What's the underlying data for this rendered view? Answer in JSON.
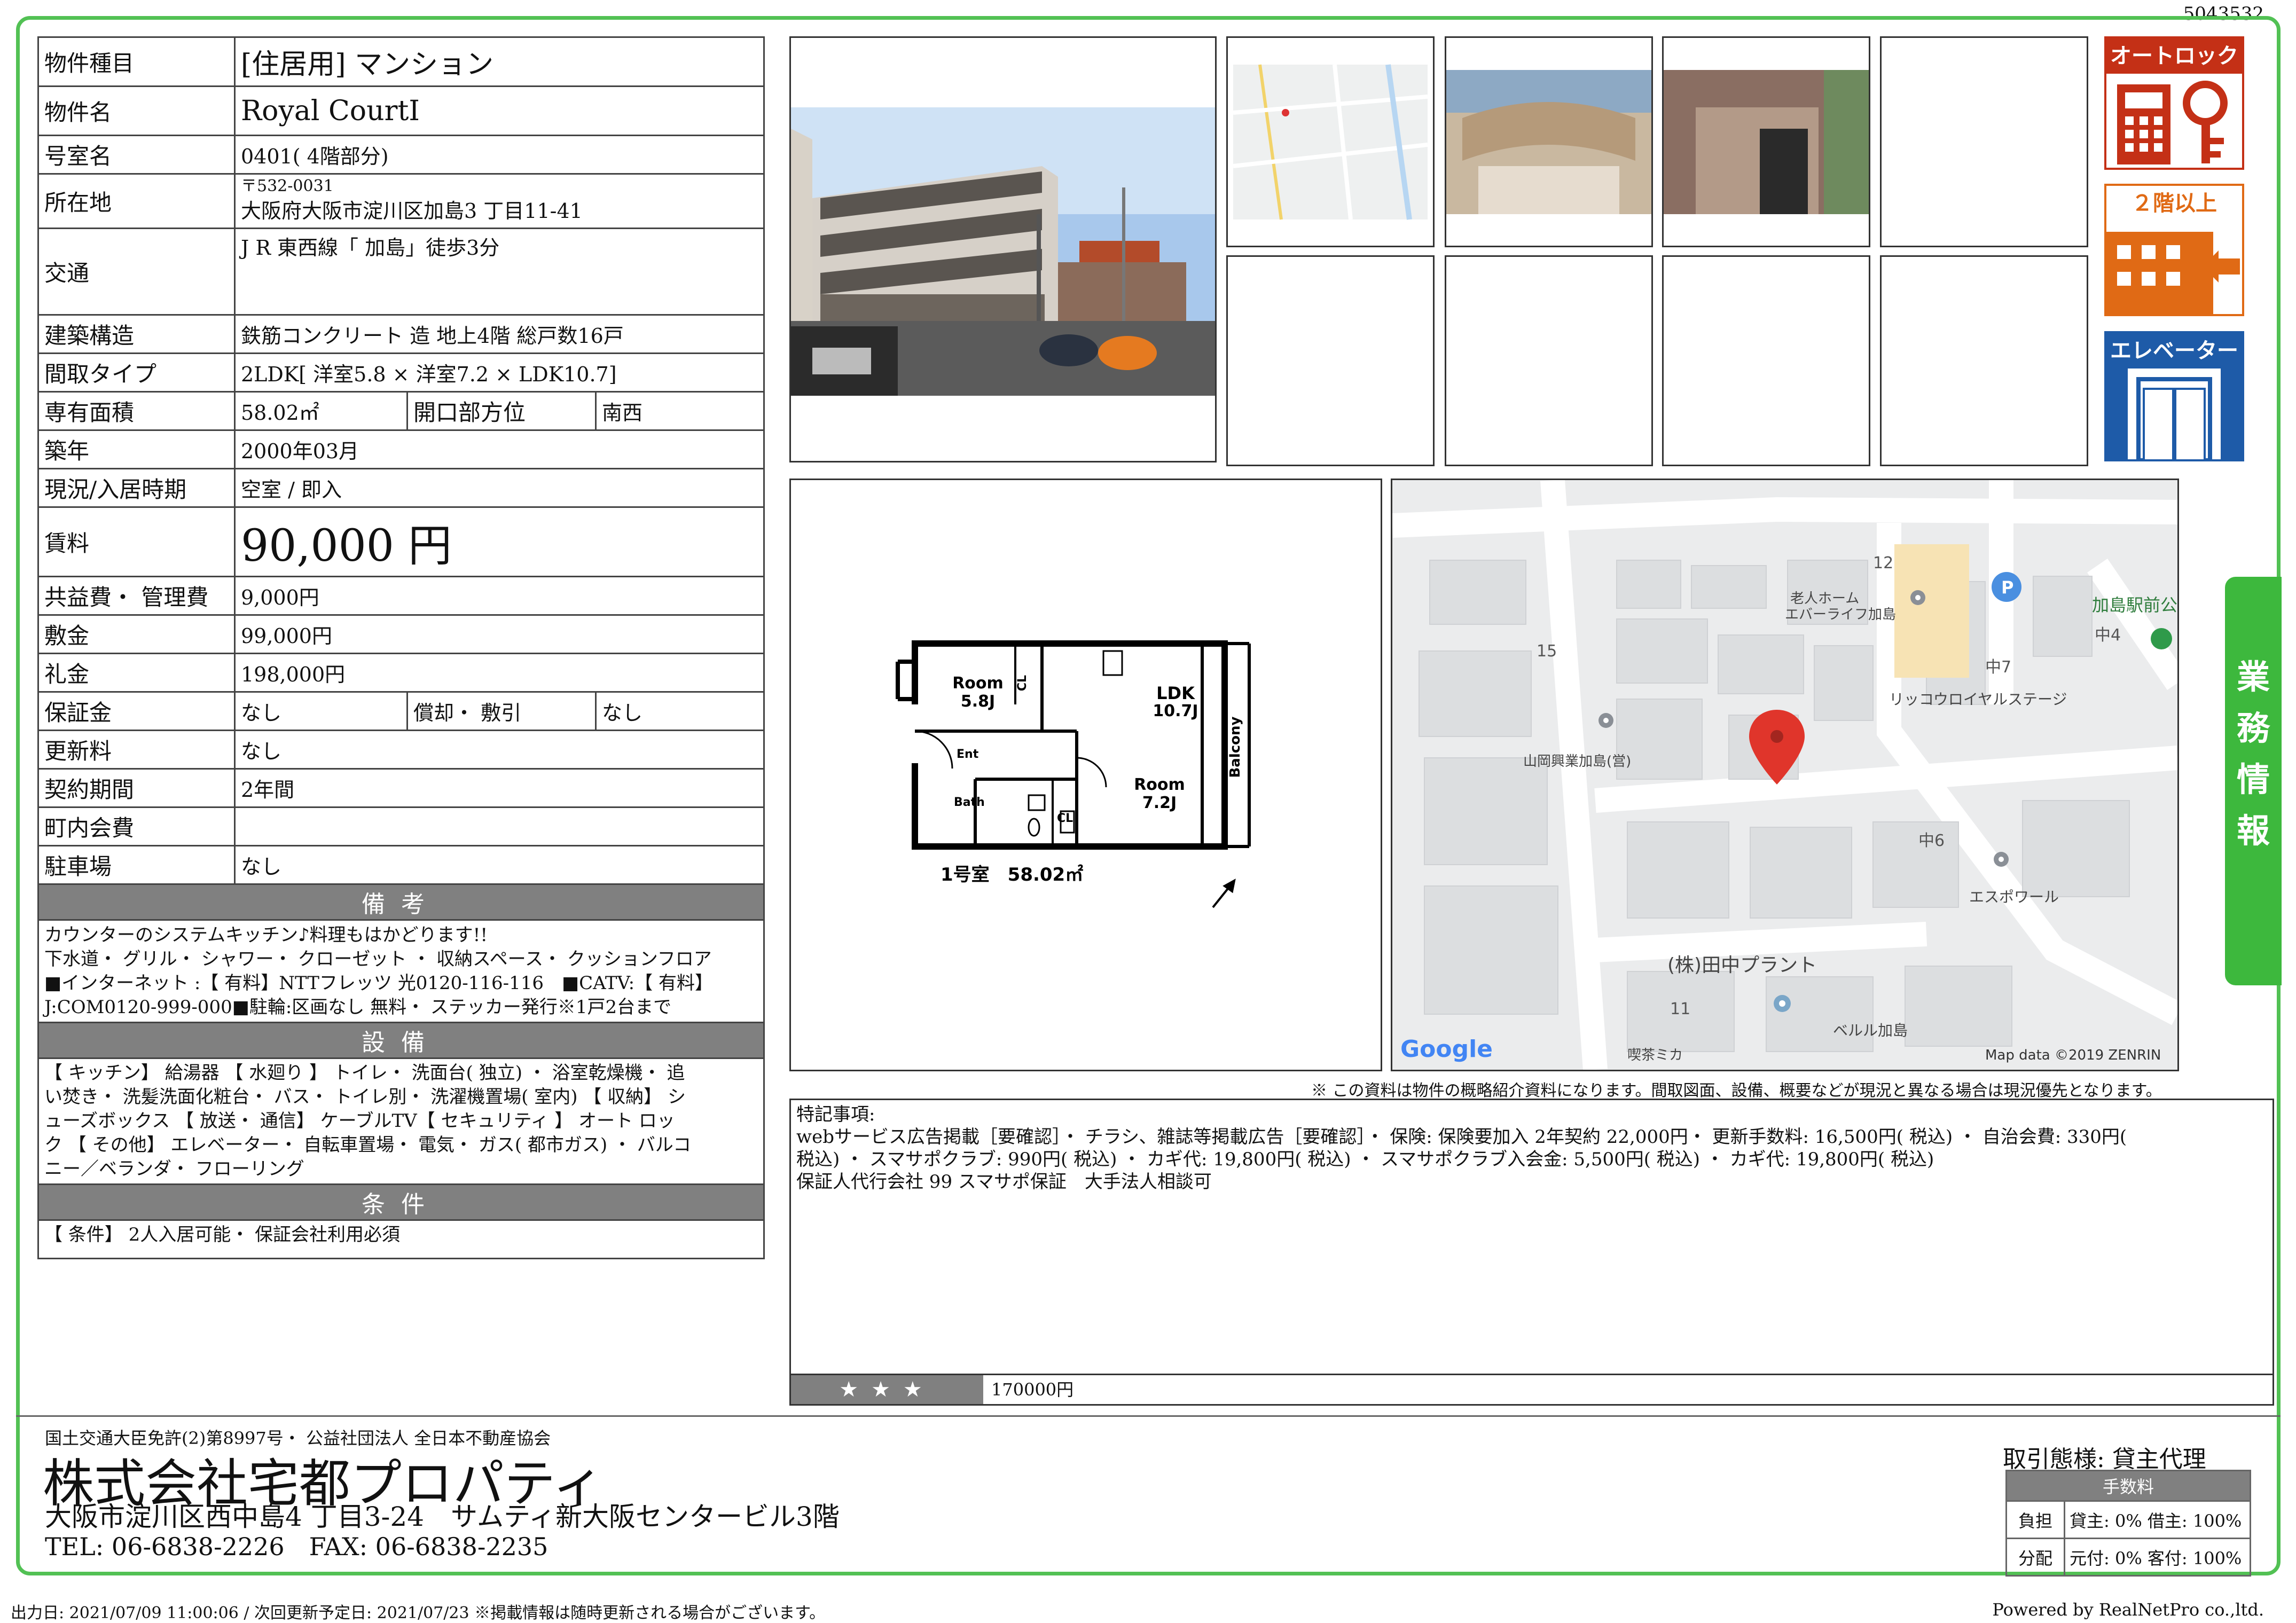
{
  "doc_id": "5043532",
  "property": {
    "type_label": "物件種目",
    "type_value": "[住居用] マンション",
    "name_label": "物件名",
    "name_value": "Royal CourtI",
    "room_label": "号室名",
    "room_value": "0401( 4階部分)",
    "location_label": "所在地",
    "postal": "〒532-0031",
    "address": "大阪府大阪市淀川区加島3 丁目11-41",
    "transport_label": "交通",
    "transport_value": "J R 東西線「 加島」徒歩3分",
    "structure_label": "建築構造",
    "structure_value": "鉄筋コンクリート 造 地上4階 総戸数16戸",
    "layout_label": "間取タイプ",
    "layout_value": "2LDK[ 洋室5.8 × 洋室7.2 × LDK10.7]",
    "area_label": "専有面積",
    "area_value": "58.02㎡",
    "direction_label": "開口部方位",
    "direction_value": "南西",
    "built_label": "築年",
    "built_value": "2000年03月",
    "status_label": "現況/入居時期",
    "status_value": "空室 / 即入",
    "rent_label": "賃料",
    "rent_value": "90,000 円",
    "common_fee_label": "共益費・ 管理費",
    "common_fee_value": "9,000円",
    "deposit_label": "敷金",
    "deposit_value": "99,000円",
    "key_money_label": "礼金",
    "key_money_value": "198,000円",
    "guarantee_label": "保証金",
    "guarantee_value": "なし",
    "amortization_label": "償却・ 敷引",
    "amortization_value": "なし",
    "renewal_label": "更新料",
    "renewal_value": "なし",
    "contract_label": "契約期間",
    "contract_value": "2年間",
    "town_fee_label": "町内会費",
    "town_fee_value": "",
    "parking_label": "駐車場",
    "parking_value": "なし"
  },
  "remarks": {
    "header": "備考",
    "lines": [
      "カウンターのシステムキッチン♪料理もはかどります!!",
      "下水道・ グリル・ シャワー・ クローゼット ・ 収納スペース・ クッションフロア",
      "■インターネット :【 有料】NTTフレッツ 光0120-116-116　■CATV:【 有料】",
      "J:COM0120-999-000■駐輪:区画なし 無料・ ステッカー発行※1戸2台まで"
    ]
  },
  "facilities": {
    "header": "設備",
    "lines": [
      "【 キッチン】 給湯器 【 水廻り 】 トイレ・ 洗面台( 独立) ・ 浴室乾燥機・ 追",
      "い焚き・ 洗髪洗面化粧台・ バス・ トイレ別・ 洗濯機置場( 室内) 【 収納】 シ",
      "ューズボックス 【 放送・ 通信】 ケーブルTV【 セキュリティ 】 オート ロッ",
      "ク 【 その他】 エレベーター・ 自転車置場・ 電気・ ガス( 都市ガス) ・ バルコ",
      "ニー／ベランダ・ フローリング"
    ]
  },
  "conditions": {
    "header": "条件",
    "lines": [
      "【 条件】 2人入居可能・ 保証会社利用必須"
    ]
  },
  "badges": {
    "autolock": "オートロック",
    "floor": "２階以上",
    "elevator": "エレベーター"
  },
  "floorplan": {
    "room1": "Room",
    "room1_size": "5.8J",
    "ldk": "LDK",
    "ldk_size": "10.7J",
    "room2": "Room",
    "room2_size": "7.2J",
    "balcony": "Balcony",
    "cl": "CL",
    "ent": "Ent",
    "bath": "Bath",
    "caption": "1号室　58.02㎡"
  },
  "map": {
    "labels": {
      "n12": "12",
      "n15": "15",
      "n11": "11",
      "naka7": "中7",
      "naka6": "中6",
      "naka4": "中4",
      "nursing1": "老人ホーム",
      "nursing2": "エバーライフ加島",
      "station_park": "加島駅前公",
      "yamaoka": "山岡興業加島(営)",
      "rikko": "リッコウロイヤルステージ",
      "espoir": "エスポワール",
      "tanaka": "(株)田中プラント",
      "beruru": "ベルル加島",
      "cafe": "喫茶ミカ",
      "google": "Google",
      "attribution": "Map data ©2019 ZENRIN"
    }
  },
  "side_tab": [
    "業",
    "務",
    "情",
    "報"
  ],
  "disclaimer": "※ この資料は物件の概略紹介資料になります。間取図面、設備、概要などが現況と異なる場合は現況優先となります。",
  "special": {
    "lines": [
      "特記事項:",
      "webサービス広告掲載［要確認］・ チラシ、雑誌等掲載広告［要確認］・ 保険: 保険要加入 2年契約 22,000円・ 更新手数料: 16,500円( 税込) ・ 自治会費: 330円(",
      "税込) ・ スマサポクラブ: 990円( 税込) ・ カギ代: 19,800円( 税込) ・ スマサポクラブ入会金: 5,500円( 税込) ・ カギ代: 19,800円( 税込)",
      "保証人代行会社 99 スマサポ保証　大手法人相談可"
    ],
    "stars": "★★★",
    "stars_value": "170000円"
  },
  "company": {
    "license": "国土交通大臣免許(2)第8997号・ 公益社団法人 全日本不動産協会",
    "name": "株式会社宅都プロパティ",
    "address": "大阪市淀川区西中島4 丁目3-24　サムティ新大阪センタービル3階",
    "tel": "TEL:  06-6838-2226　FAX:  06-6838-2235"
  },
  "deal": {
    "mode": "取引態様:  貸主代理",
    "fee_header": "手数料",
    "burden_label": "負担",
    "burden_value": "貸主: 0%  借主: 100%",
    "share_label": "分配",
    "share_value": "元付: 0%  客付: 100%"
  },
  "footer": {
    "output": "出力日: 2021/07/09 11:00:06 / 次回更新予定日: 2021/07/23 ※掲載情報は随時更新される場合がございます。",
    "powered": "Powered by RealNetPro co.,ltd."
  }
}
